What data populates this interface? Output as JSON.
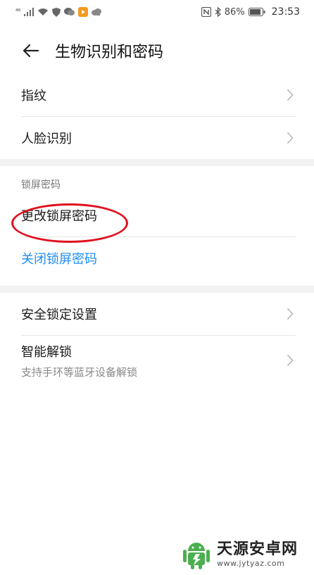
{
  "status_bar": {
    "signal_prefix": "⁴⁶",
    "battery": "86%",
    "time": "23:53"
  },
  "header": {
    "title": "生物识别和密码"
  },
  "section1": {
    "items": [
      {
        "label": "指纹"
      },
      {
        "label": "人脸识别"
      }
    ]
  },
  "section2": {
    "header": "锁屏密码",
    "change_password": "更改锁屏密码",
    "disable_password": "关闭锁屏密码"
  },
  "section3": {
    "items": [
      {
        "label": "安全锁定设置"
      },
      {
        "label": "智能解锁",
        "sub": "支持手环等蓝牙设备解锁"
      }
    ]
  },
  "watermark": {
    "title": "天源安卓网",
    "url": "www.jytyaz.com"
  },
  "colors": {
    "accent": "#1e8df0",
    "annotation": "#e0101e",
    "band": "#f2f2f2"
  }
}
